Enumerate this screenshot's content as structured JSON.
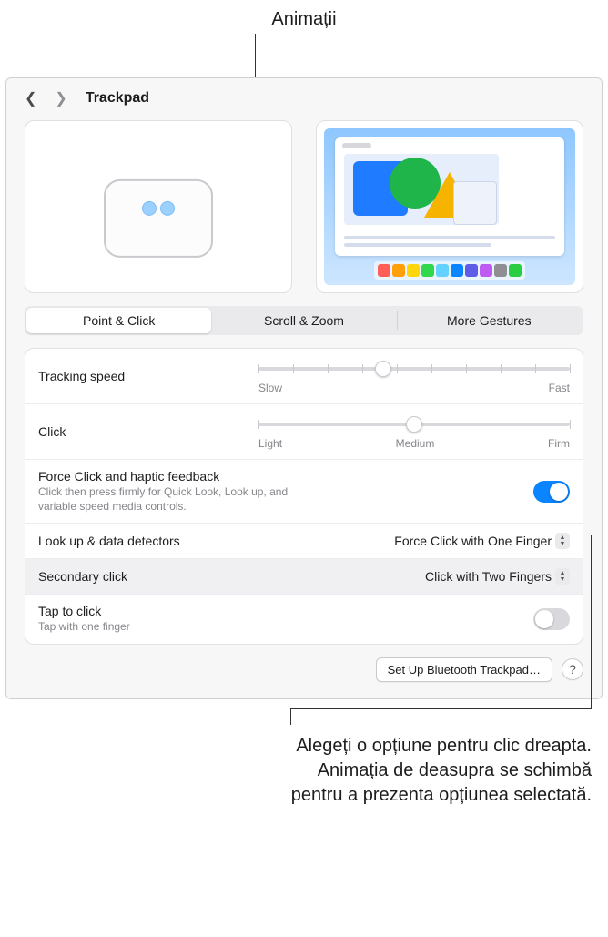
{
  "annotations": {
    "top": "Animații",
    "bottom_line1": "Alegeți o opțiune pentru clic dreapta.",
    "bottom_line2": "Animația de deasupra se schimbă",
    "bottom_line3": "pentru a prezenta opțiunea selectată."
  },
  "header": {
    "title": "Trackpad"
  },
  "tabs": {
    "point_click": "Point & Click",
    "scroll_zoom": "Scroll & Zoom",
    "more_gestures": "More Gestures"
  },
  "tracking": {
    "label": "Tracking speed",
    "min_label": "Slow",
    "max_label": "Fast",
    "value_percent": 40
  },
  "click": {
    "label": "Click",
    "min_label": "Light",
    "mid_label": "Medium",
    "max_label": "Firm",
    "value_percent": 50
  },
  "force_click": {
    "label": "Force Click and haptic feedback",
    "desc": "Click then press firmly for Quick Look, Look up, and variable speed media controls.",
    "enabled": true
  },
  "lookup": {
    "label": "Look up & data detectors",
    "value": "Force Click with One Finger"
  },
  "secondary": {
    "label": "Secondary click",
    "value": "Click with Two Fingers"
  },
  "tap": {
    "label": "Tap to click",
    "desc": "Tap with one finger",
    "enabled": false
  },
  "footer": {
    "bluetooth": "Set Up Bluetooth Trackpad…",
    "help": "?"
  },
  "dock_colors": [
    "#ff5f56",
    "#ff9f0a",
    "#ffd60a",
    "#32d74b",
    "#64d2ff",
    "#0a84ff",
    "#5e5ce6",
    "#bf5af2",
    "#8e8e93",
    "#28cd41"
  ]
}
